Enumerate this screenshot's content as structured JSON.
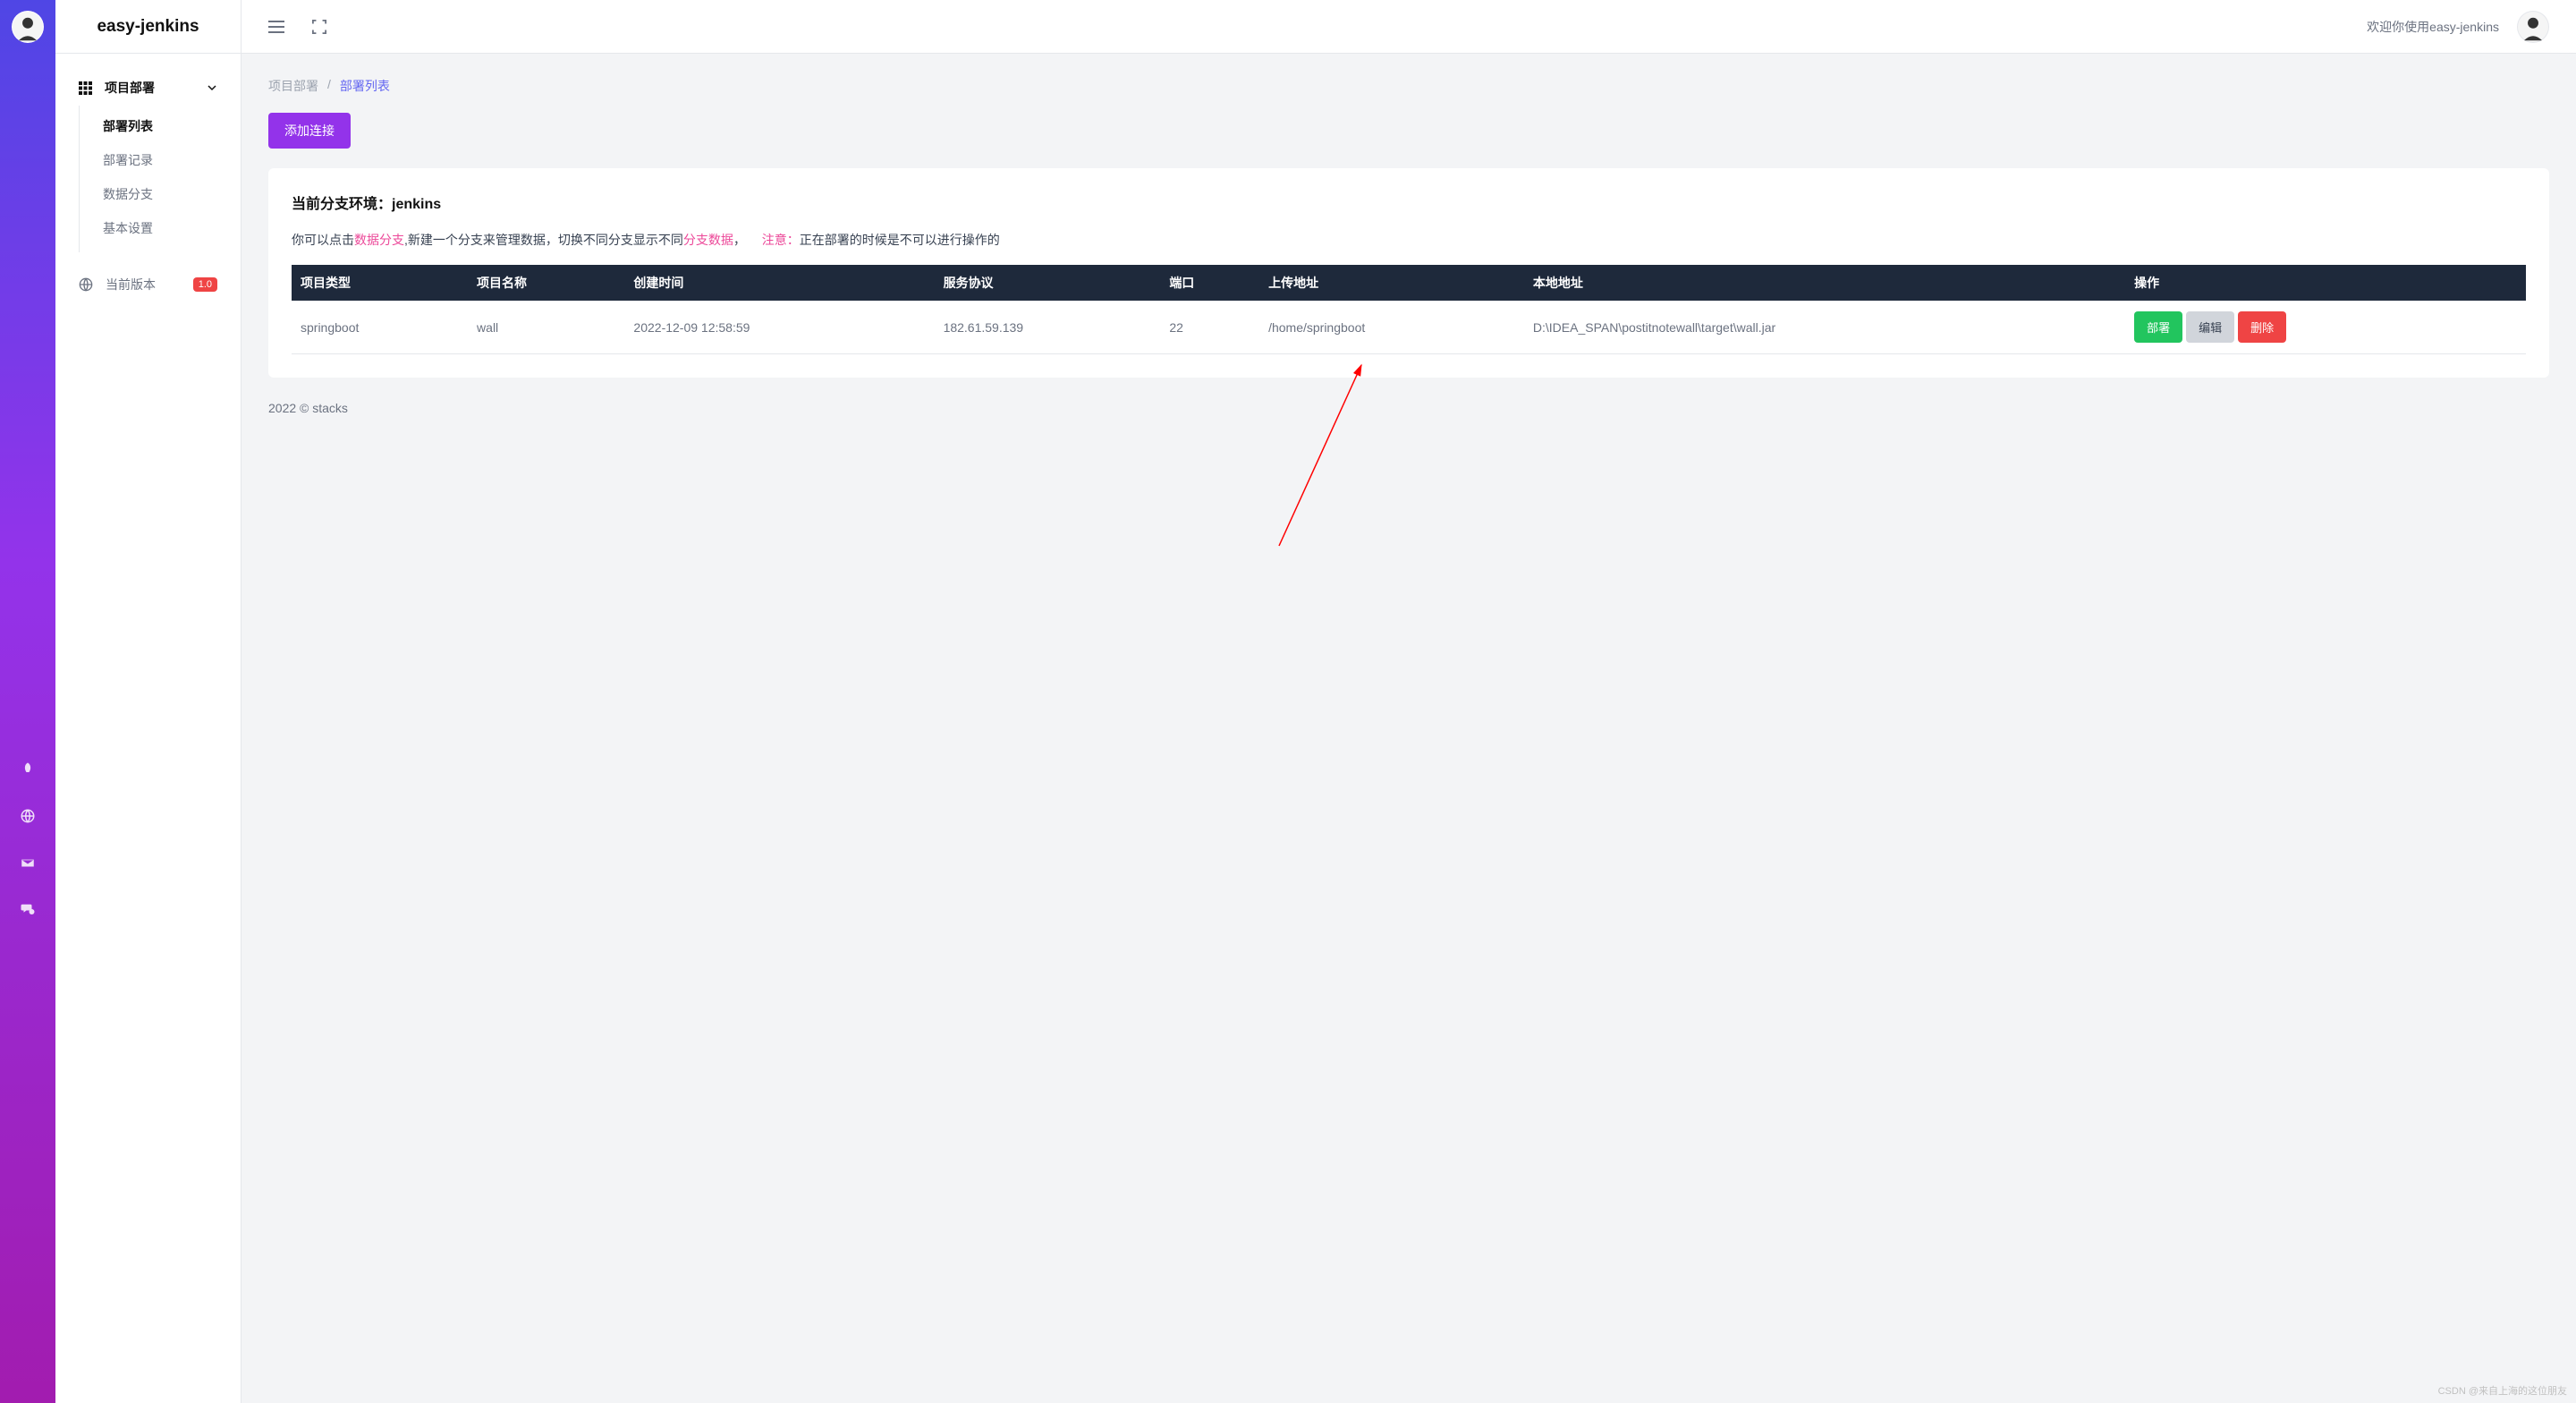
{
  "brand": "easy-jenkins",
  "topbar": {
    "welcome": "欢迎你使用easy-jenkins"
  },
  "sidebar": {
    "parent": "项目部署",
    "items": [
      {
        "label": "部署列表",
        "active": true
      },
      {
        "label": "部署记录",
        "active": false
      },
      {
        "label": "数据分支",
        "active": false
      },
      {
        "label": "基本设置",
        "active": false
      }
    ],
    "version_label": "当前版本",
    "version_badge": "1.0"
  },
  "breadcrumb": {
    "parent": "项目部署",
    "sep": "/",
    "current": "部署列表"
  },
  "buttons": {
    "add_connection": "添加连接"
  },
  "card": {
    "title": "当前分支环境：jenkins",
    "note_prefix": "你可以点击",
    "note_link1": "数据分支",
    "note_mid": ",新建一个分支来管理数据，切换不同分支显示不同",
    "note_link2": "分支数据",
    "note_comma": "，",
    "warn_label": "注意：",
    "warn_text": "正在部署的时候是不可以进行操作的"
  },
  "table": {
    "headers": [
      "项目类型",
      "项目名称",
      "创建时间",
      "服务协议",
      "端口",
      "上传地址",
      "本地地址",
      "操作"
    ],
    "rows": [
      {
        "project_type": "springboot",
        "project_name": "wall",
        "create_time": "2022-12-09 12:58:59",
        "service_protocol": "182.61.59.139",
        "port": "22",
        "upload_path": "/home/springboot",
        "local_path": "D:\\IDEA_SPAN\\postitnotewall\\target\\wall.jar"
      }
    ],
    "actions": {
      "deploy": "部署",
      "edit": "编辑",
      "delete": "删除"
    }
  },
  "footer": "2022 © stacks",
  "watermark": "CSDN @来自上海的这位朋友"
}
